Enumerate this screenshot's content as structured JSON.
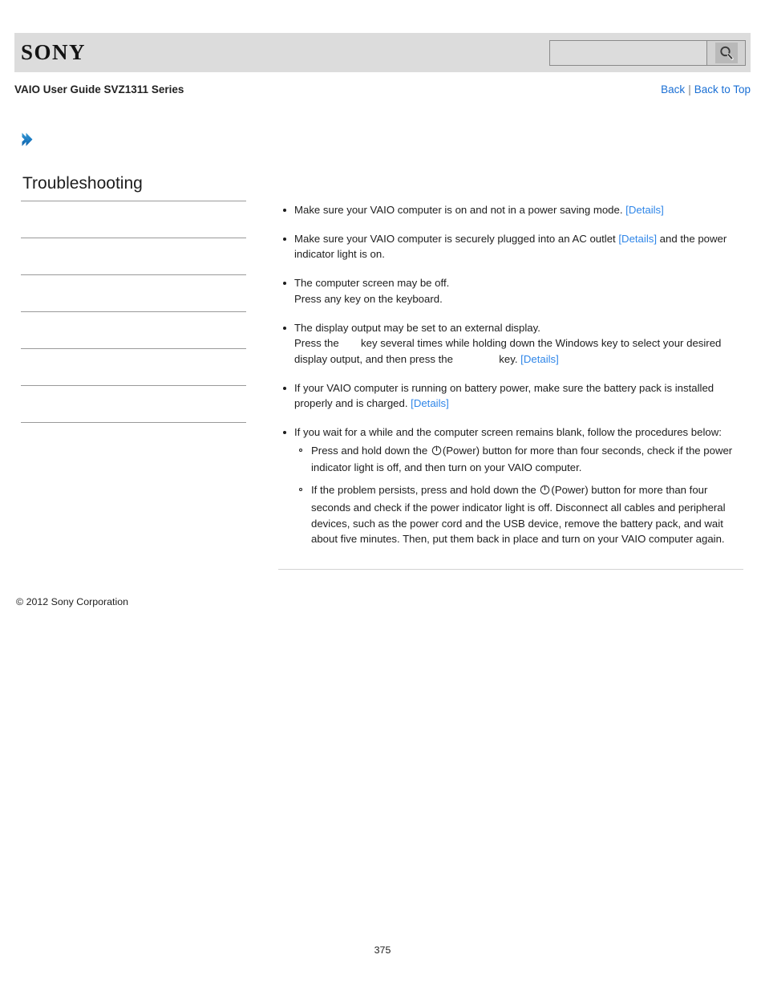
{
  "header": {
    "logo_text": "SONY",
    "logo_icon": "sony-wordmark",
    "search": {
      "value": "",
      "placeholder": "",
      "button_icon": "search-icon"
    }
  },
  "title_bar": {
    "guide_title": "VAIO User Guide SVZ1311 Series",
    "links": [
      {
        "label": "Back"
      },
      {
        "label": "Back to Top"
      }
    ],
    "separator": "|"
  },
  "breadcrumb": {
    "arrow_icon": "chevron-right-icon",
    "label": ""
  },
  "sidebar": {
    "heading": "Troubleshooting",
    "items": [
      {
        "label": ""
      },
      {
        "label": ""
      },
      {
        "label": ""
      },
      {
        "label": ""
      },
      {
        "label": ""
      },
      {
        "label": ""
      }
    ]
  },
  "content": {
    "bullets": [
      {
        "segments": [
          {
            "type": "text",
            "value": "Make sure your VAIO computer is on and not in a power saving mode. "
          },
          {
            "type": "link",
            "value": "[Details]"
          }
        ]
      },
      {
        "segments": [
          {
            "type": "text",
            "value": "Make sure your VAIO computer is securely plugged into an AC outlet "
          },
          {
            "type": "link",
            "value": "[Details]"
          },
          {
            "type": "text",
            "value": " and the power indicator light is on."
          }
        ]
      },
      {
        "segments": [
          {
            "type": "text",
            "value": "The computer screen may be off."
          },
          {
            "type": "break"
          },
          {
            "type": "text",
            "value": "Press any key on the keyboard."
          }
        ]
      },
      {
        "segments": [
          {
            "type": "text",
            "value": "The display output may be set to an external display."
          },
          {
            "type": "break"
          },
          {
            "type": "text",
            "value": "Press the "
          },
          {
            "type": "key-gap",
            "value": "narrow"
          },
          {
            "type": "text",
            "value": " key several times while holding down the Windows key to select your desired display output, and then press the "
          },
          {
            "type": "key-gap",
            "value": "wide"
          },
          {
            "type": "text",
            "value": " key. "
          },
          {
            "type": "link",
            "value": "[Details]"
          }
        ]
      },
      {
        "segments": [
          {
            "type": "text",
            "value": "If your VAIO computer is running on battery power, make sure the battery pack is installed properly and is charged. "
          },
          {
            "type": "link",
            "value": "[Details]"
          }
        ]
      },
      {
        "segments": [
          {
            "type": "text",
            "value": "If you wait for a while and the computer screen remains blank, follow the procedures below:"
          }
        ],
        "sub_bullets": [
          {
            "segments": [
              {
                "type": "text",
                "value": "Press and hold down the "
              },
              {
                "type": "power-icon",
                "value": "⏻"
              },
              {
                "type": "text",
                "value": "(Power) button for more than four seconds, check if the power indicator light is off, and then turn on your VAIO computer."
              }
            ]
          },
          {
            "segments": [
              {
                "type": "text",
                "value": "If the problem persists, press and hold down the "
              },
              {
                "type": "power-icon",
                "value": "⏻"
              },
              {
                "type": "text",
                "value": "(Power) button for more than four seconds and check if the power indicator light is off. Disconnect all cables and peripheral devices, such as the power cord and the USB device, remove the battery pack, and wait about five minutes. Then, put them back in place and turn on your VAIO computer again."
              }
            ]
          }
        ]
      }
    ]
  },
  "footer": {
    "copyright": "© 2012 Sony Corporation",
    "page_number": "375"
  },
  "colors": {
    "header_band": "#dcdcdc",
    "link_blue": "#1a6fd4",
    "details_blue": "#2f86e8",
    "arrow_blue": "#1b7cc4",
    "rule_gray": "#9a9a9a",
    "text": "#1d1d1d"
  }
}
